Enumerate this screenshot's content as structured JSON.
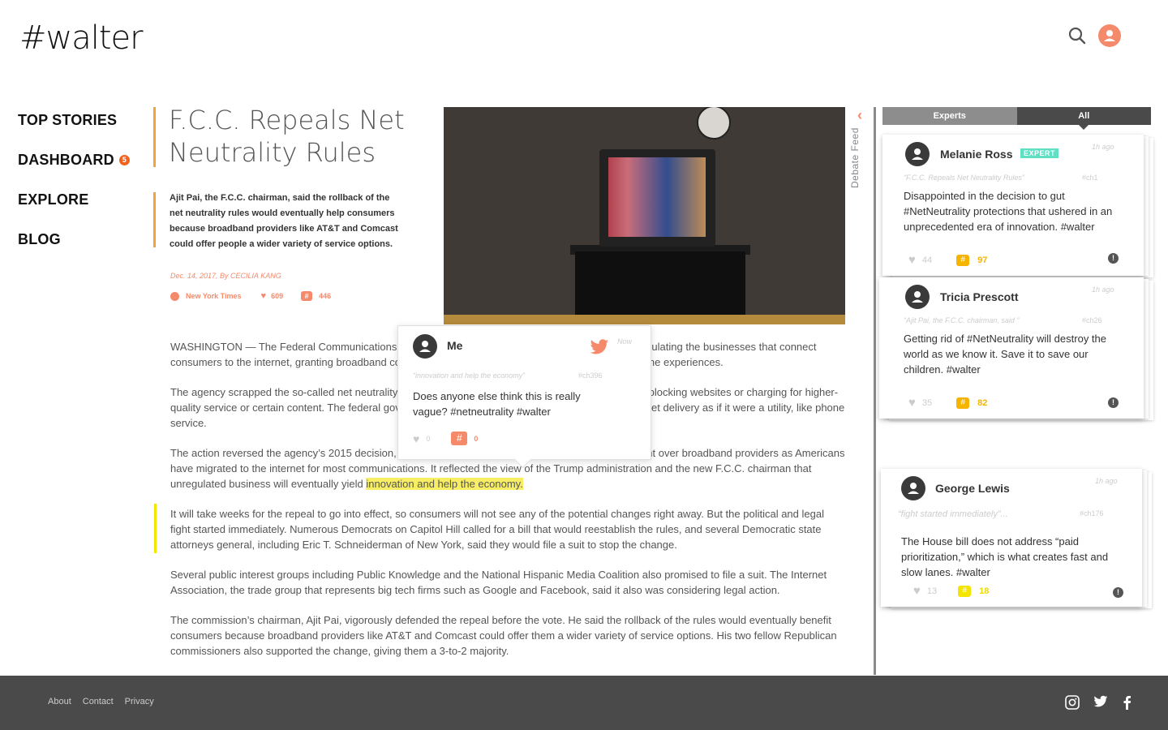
{
  "app": {
    "logo": "#walter"
  },
  "nav": {
    "top_stories": "TOP STORIES",
    "dashboard": "DASHBOARD",
    "dashboard_badge": "5",
    "explore": "EXPLORE",
    "blog": "BLOG"
  },
  "article": {
    "title": "F.C.C. Repeals Net Neutrality Rules",
    "summary": "Ajit Pai, the F.C.C. chairman, said the rollback of the net neutrality rules would eventually help consumers because broadband providers like AT&T and Comcast could offer people a wider variety of service options.",
    "byline": "Dec. 14, 2017, By CECILIA KANG",
    "source": "New York Times",
    "likes": "609",
    "hashes": "446",
    "paragraphs": [
      "WASHINGTON — The Federal Communications Commission voted on Thursday to dismantle rules regulating the businesses that connect consumers to the internet, granting broadband companies power to potentially reshape Americans’ online experiences.",
      "The agency scrapped the so-called net neutrality regulations that prohibited broadband providers from blocking websites or charging for higher-quality service or certain content. The federal government will also no longer regulate high-speed internet delivery as if it were a utility, like phone service.",
      "The action reversed the agency’s 2015 decision, during the Obama administration, to increase oversight over broadband providers as Americans have migrated to the internet for most communications. It reflected the view of the Trump administration and the new F.C.C. chairman that unregulated business will eventually yield ",
      "It will take weeks for the repeal to go into effect, so consumers will not see any of the potential changes right away. But the political and legal fight started immediately. Numerous Democrats on Capitol Hill called for a bill that would reestablish the rules, and several Democratic state attorneys general, including Eric T. Schneiderman of New York, said they would file a suit to stop the change.",
      "Several public interest groups including Public Knowledge and the National Hispanic Media Coalition also promised to file a suit. The Internet Association, the trade group that represents big tech firms such as Google and Facebook, said it also was considering legal action.",
      "The commission’s chairman, Ajit Pai, vigorously defended the repeal before the vote. He said the rollback of the rules would eventually benefit consumers because broadband providers like AT&T and Comcast could offer them a wider variety of service options. His two fellow Republican commissioners also supported the change, giving them a 3-to-2 majority."
    ],
    "highlight": "innovation and help the economy."
  },
  "popup": {
    "name": "Me",
    "time": "Now",
    "quote": "“innovation and help the economy”",
    "channel": "#ch396",
    "text": "Does anyone else think this is really vague? #netneutrality #walter",
    "likes": "0",
    "hash_symbol": "#",
    "hashes": "0"
  },
  "feed": {
    "label": "Debate Feed",
    "tab_experts": "Experts",
    "tab_all": "All",
    "cards": [
      {
        "name": "Melanie Ross",
        "badge": "EXPERT",
        "time": "1h ago",
        "quote": "“F.C.C. Repeals Net Neutrality Rules”",
        "channel": "#ch1",
        "text": "Disappointed in the decision to gut #NetNeutrality protections that ushered in an unprecedented era of innovation. #walter",
        "likes": "44",
        "hashes": "97"
      },
      {
        "name": "Tricia Prescott",
        "time": "1h ago",
        "quote": "“Ajit Pai, the F.C.C. chairman, said ”",
        "channel": "#ch26",
        "text": "Getting rid of #NetNeutrality will destroy the world as we know it. Save it to save our children. #walter",
        "likes": "35",
        "hashes": "82"
      },
      {
        "name": "George Lewis",
        "time": "1h ago",
        "quote": "“fight started immediately”...",
        "channel": "#ch176",
        "text": "The House bill does not address “paid prioritization,” which is what creates fast and slow lanes. #walter",
        "likes": "13",
        "hashes": "18"
      }
    ]
  },
  "footer": {
    "about": "About",
    "contact": "Contact",
    "privacy": "Privacy"
  },
  "colors": {
    "accent": "#f58a6b",
    "orange_bar": "#f2a33a",
    "highlight": "#f7ee63",
    "expert_badge": "#5fe0c5",
    "hash_yellow": "#f5b400"
  }
}
